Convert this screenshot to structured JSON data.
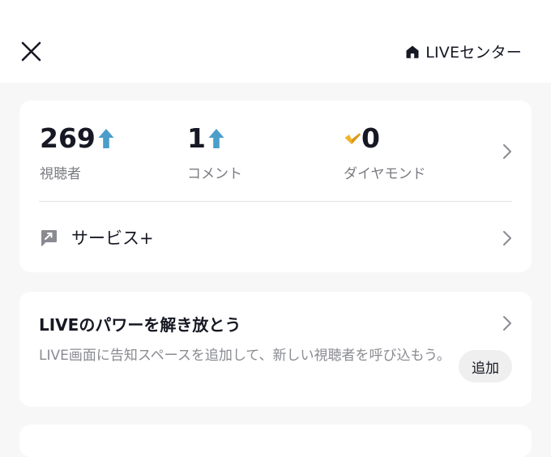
{
  "header": {
    "close_icon": "close-icon",
    "live_center_icon": "home-icon",
    "live_center_label": "LIVEセンター"
  },
  "stats": [
    {
      "value": "269",
      "label": "視聴者",
      "trend": "up"
    },
    {
      "value": "1",
      "label": "コメント",
      "trend": "up"
    },
    {
      "value": "0",
      "label": "ダイヤモンド",
      "icon": "diamond-icon"
    }
  ],
  "service": {
    "label": "サービス+",
    "icon": "service-plus-icon"
  },
  "promo": {
    "title": "LIVEのパワーを解き放とう",
    "description": "LIVE画面に告知スペースを追加して、新しい視聴者を呼び込もう。",
    "add_button": "追加"
  },
  "colors": {
    "up_arrow": "#4a9ec9",
    "diamond": "#f0b429",
    "text_primary": "#161823",
    "text_secondary": "#7a7b80",
    "background": "#f7f7f7",
    "card": "#ffffff"
  }
}
